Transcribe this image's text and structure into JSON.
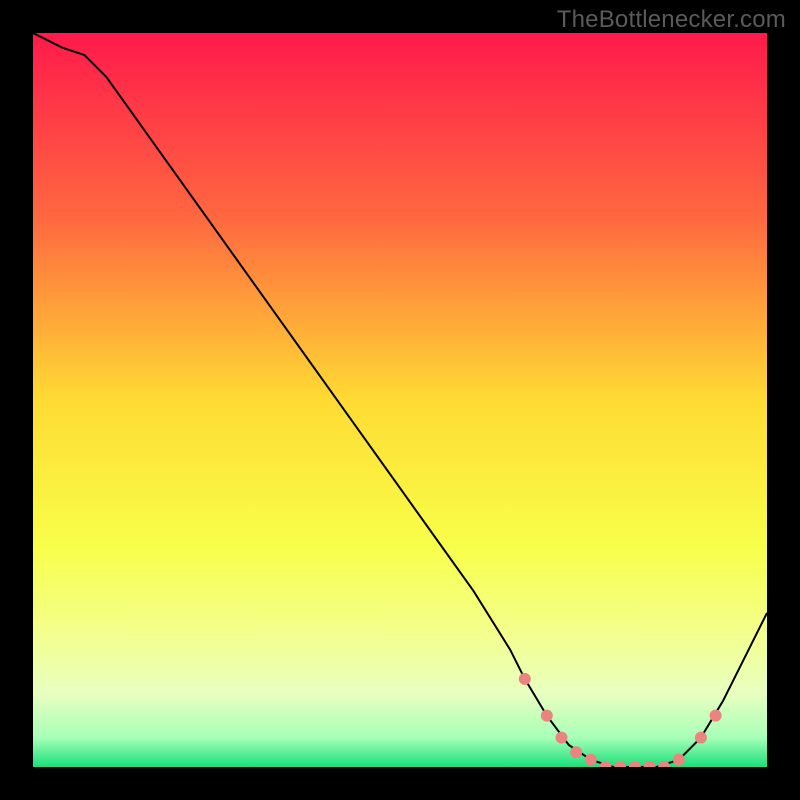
{
  "watermark": "TheBottlenecker.com",
  "chart_data": {
    "type": "line",
    "title": "",
    "xlabel": "",
    "ylabel": "",
    "xlim": [
      0,
      100
    ],
    "ylim": [
      0,
      100
    ],
    "grid": false,
    "legend": false,
    "background_gradient": {
      "stops": [
        {
          "offset": 0.0,
          "color": "#ff1a4b"
        },
        {
          "offset": 0.25,
          "color": "#ff6740"
        },
        {
          "offset": 0.5,
          "color": "#ffdb33"
        },
        {
          "offset": 0.7,
          "color": "#f8ff4a"
        },
        {
          "offset": 0.82,
          "color": "#f3ff8f"
        },
        {
          "offset": 0.9,
          "color": "#e8ffc0"
        },
        {
          "offset": 0.96,
          "color": "#a8ffb8"
        },
        {
          "offset": 1.0,
          "color": "#18e07a"
        }
      ]
    },
    "series": [
      {
        "name": "bottleneck-curve",
        "stroke": "#000000",
        "stroke_width": 2,
        "points": [
          {
            "x": 0,
            "y": 100
          },
          {
            "x": 2,
            "y": 99
          },
          {
            "x": 4,
            "y": 98
          },
          {
            "x": 7,
            "y": 97
          },
          {
            "x": 10,
            "y": 94
          },
          {
            "x": 15,
            "y": 87
          },
          {
            "x": 20,
            "y": 80
          },
          {
            "x": 25,
            "y": 73
          },
          {
            "x": 30,
            "y": 66
          },
          {
            "x": 35,
            "y": 59
          },
          {
            "x": 40,
            "y": 52
          },
          {
            "x": 45,
            "y": 45
          },
          {
            "x": 50,
            "y": 38
          },
          {
            "x": 55,
            "y": 31
          },
          {
            "x": 60,
            "y": 24
          },
          {
            "x": 65,
            "y": 16
          },
          {
            "x": 67,
            "y": 12
          },
          {
            "x": 70,
            "y": 7
          },
          {
            "x": 73,
            "y": 3
          },
          {
            "x": 76,
            "y": 1
          },
          {
            "x": 79,
            "y": 0
          },
          {
            "x": 82,
            "y": 0
          },
          {
            "x": 85,
            "y": 0
          },
          {
            "x": 88,
            "y": 1
          },
          {
            "x": 91,
            "y": 4
          },
          {
            "x": 94,
            "y": 9
          },
          {
            "x": 97,
            "y": 15
          },
          {
            "x": 100,
            "y": 21
          }
        ]
      }
    ],
    "markers": {
      "name": "highlight-dots",
      "fill": "#e9847f",
      "radius": 6,
      "points": [
        {
          "x": 67,
          "y": 12
        },
        {
          "x": 70,
          "y": 7
        },
        {
          "x": 72,
          "y": 4
        },
        {
          "x": 74,
          "y": 2
        },
        {
          "x": 76,
          "y": 1
        },
        {
          "x": 78,
          "y": 0
        },
        {
          "x": 80,
          "y": 0
        },
        {
          "x": 82,
          "y": 0
        },
        {
          "x": 84,
          "y": 0
        },
        {
          "x": 86,
          "y": 0
        },
        {
          "x": 88,
          "y": 1
        },
        {
          "x": 91,
          "y": 4
        },
        {
          "x": 93,
          "y": 7
        }
      ]
    }
  }
}
